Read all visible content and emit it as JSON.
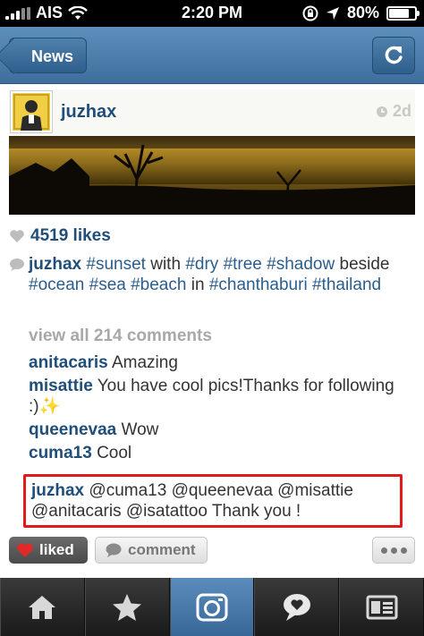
{
  "status_bar": {
    "carrier": "AIS",
    "time": "2:20 PM",
    "battery_percent": "80%",
    "battery_level": 0.8
  },
  "nav": {
    "back_label": "News",
    "refresh_icon": "refresh-icon"
  },
  "post": {
    "username": "juzhax",
    "time_ago": "2d",
    "likes": "4519 likes",
    "caption": {
      "user": "juzhax",
      "segments": [
        {
          "t": "#sunset",
          "tag": true
        },
        {
          "t": " with ",
          "tag": false
        },
        {
          "t": "#dry",
          "tag": true
        },
        {
          "t": " ",
          "tag": false
        },
        {
          "t": "#tree",
          "tag": true
        },
        {
          "t": " ",
          "tag": false
        },
        {
          "t": "#shadow",
          "tag": true
        },
        {
          "t": " beside ",
          "tag": false
        },
        {
          "t": "#ocean",
          "tag": true
        },
        {
          "t": " ",
          "tag": false
        },
        {
          "t": "#sea",
          "tag": true
        },
        {
          "t": " ",
          "tag": false
        },
        {
          "t": "#beach",
          "tag": true
        },
        {
          "t": " in ",
          "tag": false
        },
        {
          "t": "#chanthaburi",
          "tag": true
        },
        {
          "t": " ",
          "tag": false
        },
        {
          "t": "#thailand",
          "tag": true
        }
      ]
    },
    "view_all": "view all 214 comments",
    "comments": [
      {
        "user": "anitacaris",
        "text": "Amazing"
      },
      {
        "user": "misattie",
        "text": "You have cool pics!Thanks for following :)✨"
      },
      {
        "user": "queenevaa",
        "text": "Wow"
      },
      {
        "user": "cuma13",
        "text": "Cool"
      },
      {
        "user": "juzhax",
        "text": "@cuma13 @queenevaa @misattie @anitacaris @isatattoo Thank you !"
      }
    ]
  },
  "actions": {
    "liked_label": "liked",
    "comment_label": "comment"
  },
  "tab_bar": {
    "tabs": [
      "home-icon",
      "star-icon",
      "camera-icon",
      "news-bubble-icon",
      "profile-icon"
    ],
    "active_index": 2
  },
  "colors": {
    "nav_blue": "#4a7cab",
    "username_blue": "#1f4e7a",
    "highlight_red": "#e01b1b"
  }
}
